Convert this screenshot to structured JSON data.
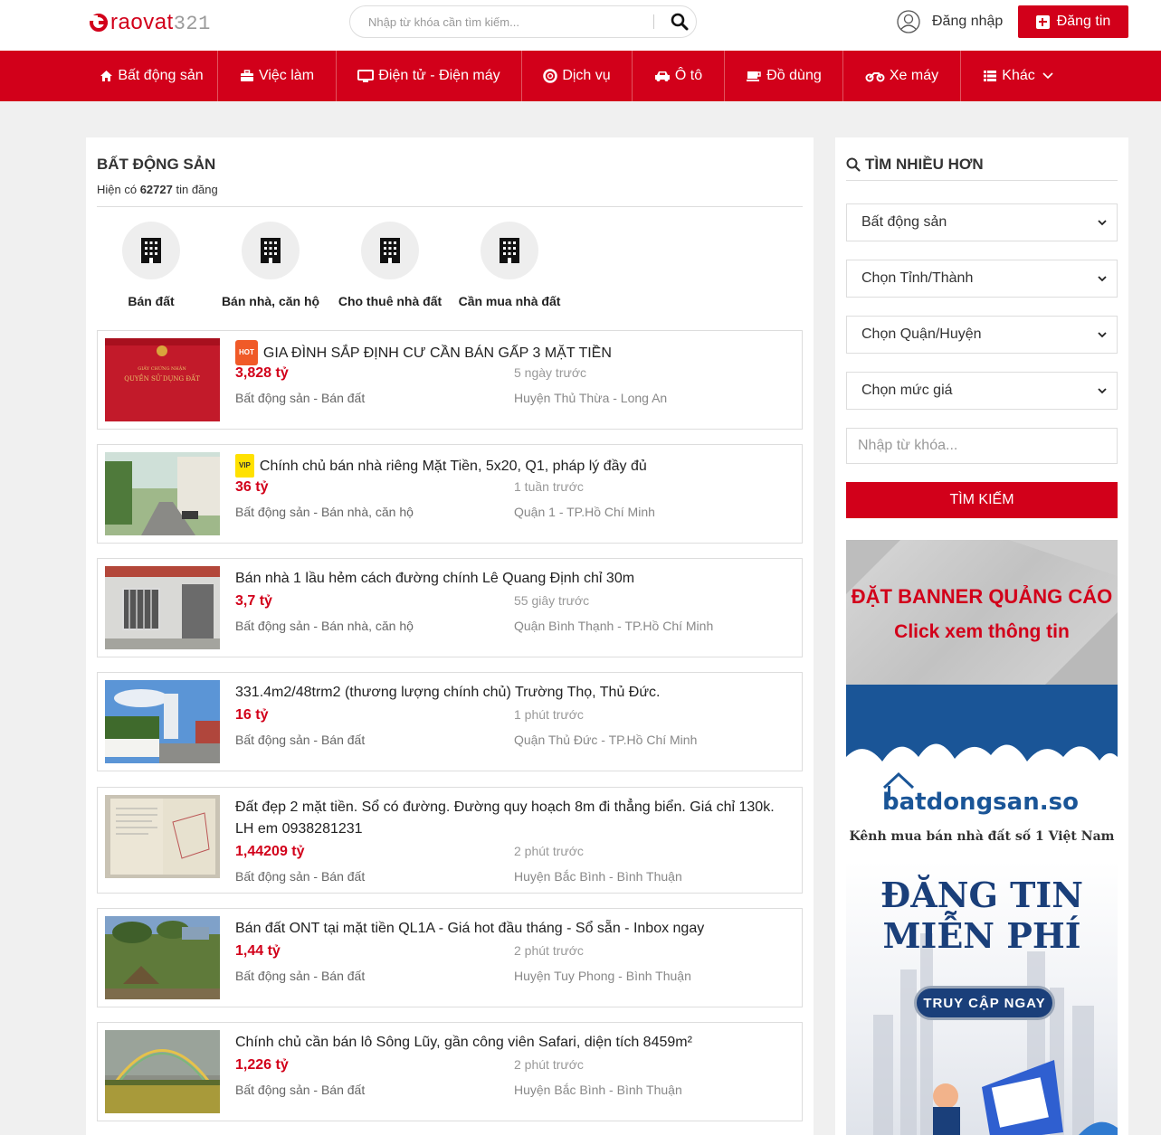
{
  "header": {
    "logo_text_red": "raovat",
    "logo_text_grey": "321",
    "search_placeholder": "Nhập từ khóa cần tìm kiếm...",
    "login_label": "Đăng nhập",
    "post_label": "Đăng tin"
  },
  "nav": {
    "items": [
      {
        "label": "Bất động sản",
        "icon": "home-icon"
      },
      {
        "label": "Việc làm",
        "icon": "briefcase-icon"
      },
      {
        "label": "Điện tử - Điện máy",
        "icon": "monitor-icon"
      },
      {
        "label": "Dịch vụ",
        "icon": "lifebuoy-icon"
      },
      {
        "label": "Ô tô",
        "icon": "car-icon"
      },
      {
        "label": "Đồ dùng",
        "icon": "coffee-icon"
      },
      {
        "label": "Xe máy",
        "icon": "motorbike-icon"
      },
      {
        "label": "Khác",
        "icon": "list-icon"
      }
    ]
  },
  "main": {
    "title": "BẤT ĐỘNG SẢN",
    "count_prefix": "Hiện có",
    "count_value": "62727",
    "count_suffix": "tin đăng",
    "categories": [
      {
        "label": "Bán đất",
        "icon": "building-icon"
      },
      {
        "label": "Bán nhà, căn hộ",
        "icon": "building-icon"
      },
      {
        "label": "Cho thuê nhà đất",
        "icon": "building-icon"
      },
      {
        "label": "Cần mua nhà đất",
        "icon": "building-icon"
      }
    ],
    "listings": [
      {
        "badge": "HOT",
        "title": "GIA ĐÌNH SẮP ĐỊNH CƯ CẦN BÁN GẤP 3 MẶT TIỀN",
        "price": "3,828 tỷ",
        "time": "5 ngày trước",
        "category": "Bất động sản - Bán đất",
        "location": "Huyện Thủ Thừa - Long An",
        "thumb_text_1": "GIẤY CHỨNG NHẬN",
        "thumb_text_2": "QUYỀN SỬ DỤNG ĐẤT"
      },
      {
        "badge": "VIP",
        "title": "Chính chủ bán nhà riêng Mặt Tiền, 5x20, Q1, pháp lý đầy đủ",
        "price": "36 tỷ",
        "time": "1 tuần trước",
        "category": "Bất động sản - Bán nhà, căn hộ",
        "location": "Quận 1 - TP.Hồ Chí Minh"
      },
      {
        "badge": "",
        "title": "Bán nhà 1 lầu hẻm cách đường chính Lê Quang Định chỉ 30m",
        "price": "3,7 tỷ",
        "time": "55 giây trước",
        "category": "Bất động sản - Bán nhà, căn hộ",
        "location": "Quận Bình Thạnh - TP.Hồ Chí Minh"
      },
      {
        "badge": "",
        "title": "331.4m2/48trm2 (thương lượng chính chủ) Trường Thọ, Thủ Đức.",
        "price": "16 tỷ",
        "time": "1 phút trước",
        "category": "Bất động sản - Bán đất",
        "location": "Quận Thủ Đức - TP.Hồ Chí Minh"
      },
      {
        "badge": "",
        "title": "Đất đẹp 2 mặt tiền. Sổ có đường. Đường quy hoạch 8m đi thẳng biển. Giá chỉ 130k. LH em 0938281231",
        "price": "1,44209 tỷ",
        "time": "2 phút trước",
        "category": "Bất động sản - Bán đất",
        "location": "Huyện Bắc Bình - Bình Thuận"
      },
      {
        "badge": "",
        "title": "Bán đất ONT tại mặt tiền QL1A - Giá hot đầu tháng - Sổ sẵn - Inbox ngay",
        "price": "1,44 tỷ",
        "time": "2 phút trước",
        "category": "Bất động sản - Bán đất",
        "location": "Huyện Tuy Phong - Bình Thuận"
      },
      {
        "badge": "",
        "title": "Chính chủ cần bán lô Sông Lũy, gần công viên Safari, diện tích 8459m²",
        "price": "1,226 tỷ",
        "time": "2 phút trước",
        "category": "Bất động sản - Bán đất",
        "location": "Huyện Bắc Bình - Bình Thuận"
      }
    ]
  },
  "sidebar": {
    "title": "TÌM NHIỀU HƠN",
    "selects": [
      "Bất động sản",
      "Chọn Tỉnh/Thành",
      "Chọn Quận/Huyện",
      "Chọn mức giá"
    ],
    "keyword_placeholder": "Nhập từ khóa...",
    "search_button": "TÌM KIẾM",
    "banner1": {
      "line1": "ĐẶT BANNER QUẢNG CÁO",
      "line2": "Click xem thông tin"
    },
    "banner2": {
      "brand": "batdongsan.so",
      "tagline": "Kênh mua bán nhà đất số 1 Việt Nam",
      "free_line1": "ĐĂNG TIN",
      "free_line2": "MIỄN PHÍ",
      "cta": "TRUY CẬP NGAY"
    }
  },
  "colors": {
    "brand_red": "#d2001a",
    "badge_hot": "#f05a28",
    "badge_vip": "#ffe100",
    "banner_blue": "#1a3f7a"
  }
}
